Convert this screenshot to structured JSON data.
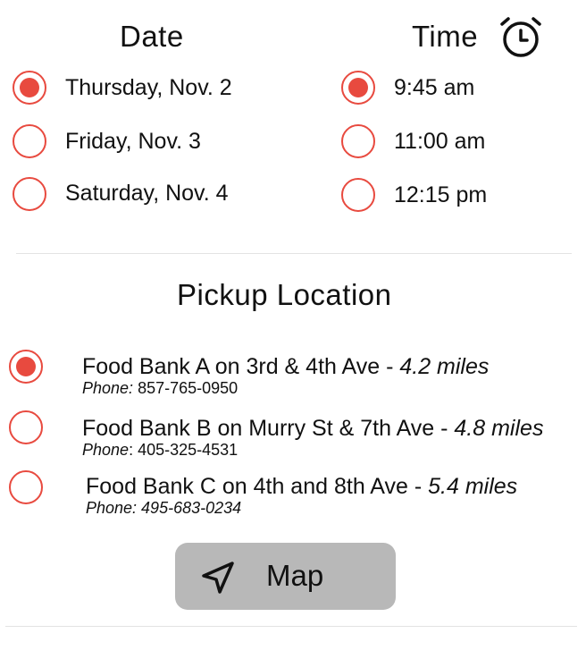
{
  "date": {
    "heading": "Date",
    "options": [
      {
        "label": "Thursday, Nov. 2",
        "selected": true
      },
      {
        "label": "Friday, Nov. 3",
        "selected": false
      },
      {
        "label": "Saturday, Nov. 4",
        "selected": false
      }
    ]
  },
  "time": {
    "heading": "Time",
    "icon": "alarm-clock-icon",
    "options": [
      {
        "label": "9:45 am",
        "selected": true
      },
      {
        "label": "11:00 am",
        "selected": false
      },
      {
        "label": "12:15 pm",
        "selected": false
      }
    ]
  },
  "pickup": {
    "heading": "Pickup Location",
    "locations": [
      {
        "name": "Food Bank A on 3rd & 4th Ave - ",
        "distance": "4.2 miles",
        "phone_label": "Phone:",
        "phone": " 857-765-0950",
        "selected": true
      },
      {
        "name": "Food Bank B on Murry St & 7th Ave - ",
        "distance": "4.8 miles",
        "phone_label": "Phone",
        "phone": ": 405-325-4531",
        "selected": false
      },
      {
        "name": "Food Bank C on 4th and 8th Ave - ",
        "distance": "5.4 miles",
        "phone_label": "Phone: 495-683-0234",
        "phone": "",
        "selected": false
      }
    ]
  },
  "map_button": {
    "label": "Map",
    "icon": "navigation-arrow-icon"
  },
  "colors": {
    "accent": "#e84a3f",
    "button_bg": "#b8b8b8",
    "divider": "#e3e3e3"
  }
}
